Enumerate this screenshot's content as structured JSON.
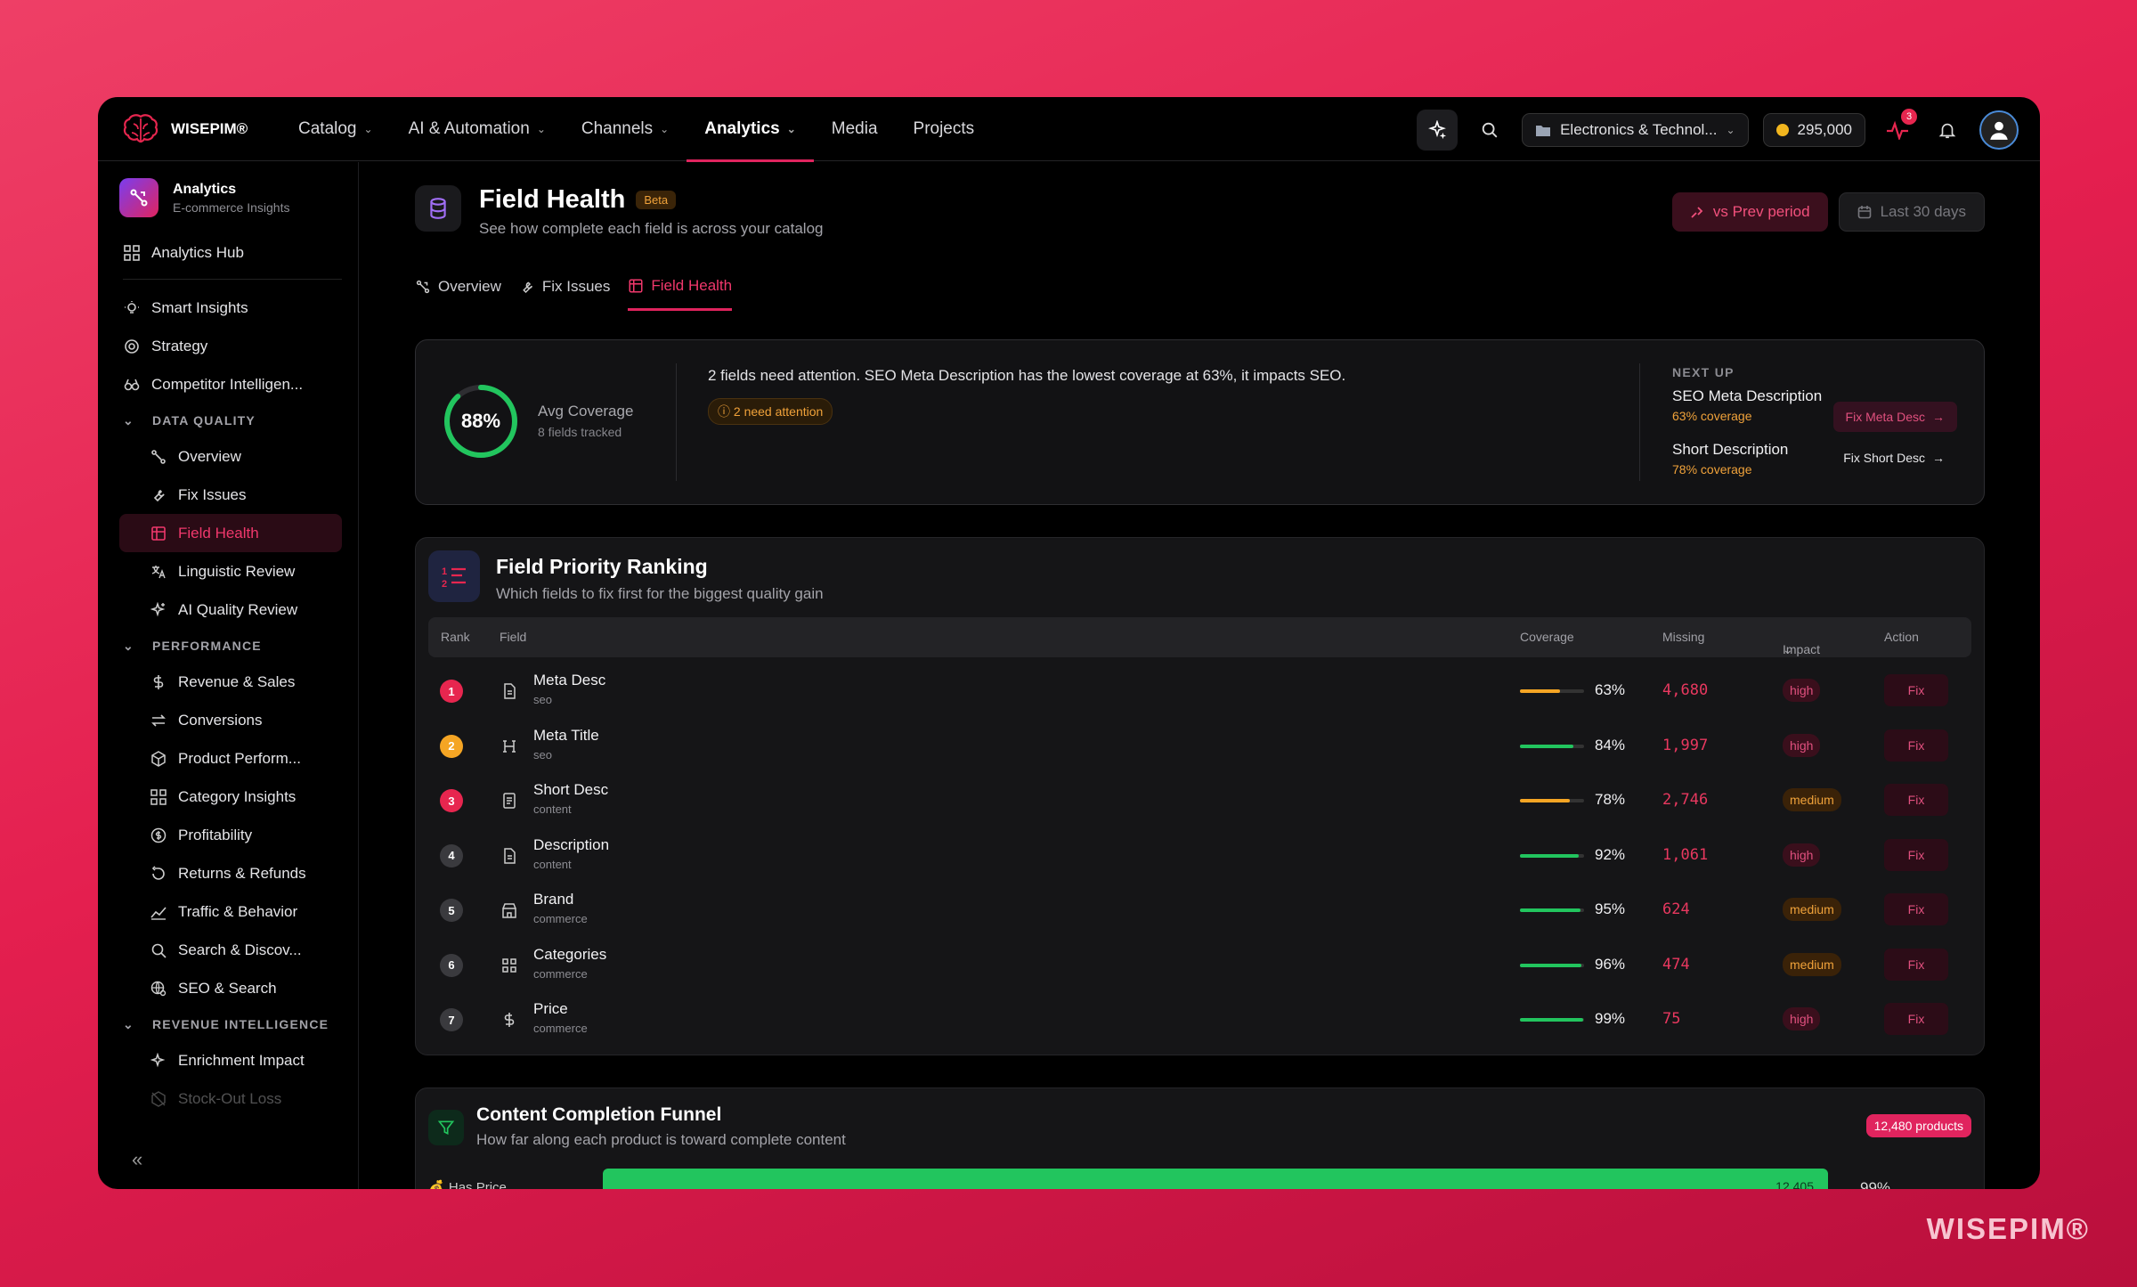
{
  "brand": {
    "name": "WISEPIM®",
    "watermark": "WISEPIM®",
    "accent": "#e0245e"
  },
  "nav": {
    "items": [
      {
        "label": "Catalog",
        "has_menu": true
      },
      {
        "label": "AI & Automation",
        "has_menu": true
      },
      {
        "label": "Channels",
        "has_menu": true
      },
      {
        "label": "Analytics",
        "has_menu": true,
        "active": true
      },
      {
        "label": "Media",
        "has_menu": false
      },
      {
        "label": "Projects",
        "has_menu": false
      }
    ]
  },
  "topbar": {
    "workspace": "Electronics & Technol...",
    "credits": "295,000",
    "activity_count": "3"
  },
  "sidebar": {
    "app_title": "Analytics",
    "app_subtitle": "E-commerce Insights",
    "hub": "Analytics Hub",
    "top_items": [
      "Smart Insights",
      "Strategy",
      "Competitor Intelligen..."
    ],
    "sections": [
      {
        "title": "DATA QUALITY",
        "items": [
          "Overview",
          "Fix Issues",
          "Field Health",
          "Linguistic Review",
          "AI Quality Review"
        ]
      },
      {
        "title": "PERFORMANCE",
        "items": [
          "Revenue & Sales",
          "Conversions",
          "Product Perform...",
          "Category Insights",
          "Profitability",
          "Returns & Refunds",
          "Traffic & Behavior",
          "Search & Discov...",
          "SEO & Search"
        ]
      },
      {
        "title": "REVENUE INTELLIGENCE",
        "items": [
          "Enrichment Impact",
          "Stock-Out Loss"
        ]
      }
    ],
    "active_item": "Field Health"
  },
  "page": {
    "title": "Field Health",
    "badge": "Beta",
    "subtitle": "See how complete each field is across your catalog",
    "compare_label": "vs Prev period",
    "range_label": "Last 30 days"
  },
  "tabs": [
    "Overview",
    "Fix Issues",
    "Field Health"
  ],
  "summary": {
    "avg_value": "88%",
    "avg_fraction": 0.88,
    "avg_label": "Avg Coverage",
    "fields_tracked": "8 fields tracked",
    "message": "2 fields need attention. SEO Meta Description has the lowest coverage at 63%, it impacts SEO.",
    "attention": "2 need attention",
    "next_up_title": "NEXT UP",
    "next": [
      {
        "field": "SEO Meta Description",
        "coverage": "63% coverage",
        "action": "Fix Meta Desc"
      },
      {
        "field": "Short Description",
        "coverage": "78% coverage",
        "action": "Fix Short Desc"
      }
    ]
  },
  "ranking": {
    "title": "Field Priority Ranking",
    "subtitle": "Which fields to fix first for the biggest quality gain",
    "columns": [
      "Rank",
      "Field",
      "Coverage",
      "Missing",
      "Impact",
      "Action"
    ],
    "rows": [
      {
        "rank": "1",
        "field": "Meta Desc",
        "category": "seo",
        "coverage": "63%",
        "coverage_value": 63,
        "missing": "4,680",
        "impact": "high",
        "action": "Fix",
        "rank_color": "#e7264f",
        "bar_color": "#f5a524"
      },
      {
        "rank": "2",
        "field": "Meta Title",
        "category": "seo",
        "coverage": "84%",
        "coverage_value": 84,
        "missing": "1,997",
        "impact": "high",
        "action": "Fix",
        "rank_color": "#f5a524",
        "bar_color": "#22c55e"
      },
      {
        "rank": "3",
        "field": "Short Desc",
        "category": "content",
        "coverage": "78%",
        "coverage_value": 78,
        "missing": "2,746",
        "impact": "medium",
        "action": "Fix",
        "rank_color": "#e7264f",
        "bar_color": "#f5a524"
      },
      {
        "rank": "4",
        "field": "Description",
        "category": "content",
        "coverage": "92%",
        "coverage_value": 92,
        "missing": "1,061",
        "impact": "high",
        "action": "Fix",
        "rank_color": "#3a3a3e",
        "bar_color": "#22c55e"
      },
      {
        "rank": "5",
        "field": "Brand",
        "category": "commerce",
        "coverage": "95%",
        "coverage_value": 95,
        "missing": "624",
        "impact": "medium",
        "action": "Fix",
        "rank_color": "#3a3a3e",
        "bar_color": "#22c55e"
      },
      {
        "rank": "6",
        "field": "Categories",
        "category": "commerce",
        "coverage": "96%",
        "coverage_value": 96,
        "missing": "474",
        "impact": "medium",
        "action": "Fix",
        "rank_color": "#3a3a3e",
        "bar_color": "#22c55e"
      },
      {
        "rank": "7",
        "field": "Price",
        "category": "commerce",
        "coverage": "99%",
        "coverage_value": 99,
        "missing": "75",
        "impact": "high",
        "action": "Fix",
        "rank_color": "#3a3a3e",
        "bar_color": "#22c55e"
      }
    ]
  },
  "funnel": {
    "title": "Content Completion Funnel",
    "subtitle": "How far along each product is toward complete content",
    "badge": "12,480 products",
    "first_label": "Has Price",
    "first_count": "12,405",
    "first_pct": "99%"
  }
}
